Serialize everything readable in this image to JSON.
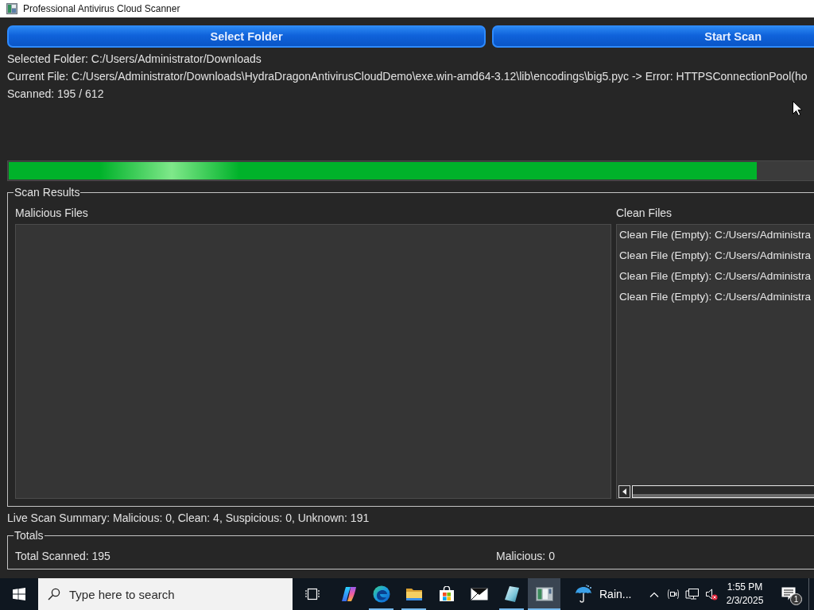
{
  "window": {
    "title": "Professional Antivirus Cloud Scanner"
  },
  "buttons": [
    {
      "label": "Select Folder"
    },
    {
      "label": "Start Scan"
    }
  ],
  "status": {
    "selected_folder": "Selected Folder: C:/Users/Administrator/Downloads",
    "current_file": "Current File: C:/Users/Administrator/Downloads\\HydraDragonAntivirusCloudDemo\\exe.win-amd64-3.12\\lib\\encodings\\big5.pyc -> Error: HTTPSConnectionPool(ho",
    "scanned": "Scanned: 195 / 612"
  },
  "progress": {
    "level": 0.93
  },
  "scan_results": {
    "title": "Scan Results",
    "malicious_files": {
      "label": "Malicious Files"
    },
    "clean_files": {
      "label": "Clean Files",
      "items": [
        "Clean File (Empty): C:/Users/Administra",
        "Clean File (Empty): C:/Users/Administra",
        "Clean File (Empty): C:/Users/Administra",
        "Clean File (Empty): C:/Users/Administra"
      ]
    }
  },
  "summary": "Live Scan Summary: Malicious: 0, Clean: 4, Suspicious: 0, Unknown: 191",
  "totals": {
    "title": "Totals",
    "total_scanned": "Total Scanned: 195",
    "malicious": "Malicious: 0"
  },
  "taskbar": {
    "search": {
      "placeholder": "Type here to search"
    },
    "apps": [
      {
        "kind": "swirl",
        "running": false,
        "selected": false
      },
      {
        "kind": "globe",
        "running": true,
        "selected": false
      },
      {
        "kind": "folder",
        "running": true,
        "selected": false
      },
      {
        "kind": "bag",
        "running": false,
        "selected": false
      },
      {
        "kind": "envelope",
        "running": false,
        "selected": false
      },
      {
        "kind": "note",
        "running": true,
        "selected": false
      },
      {
        "kind": "window",
        "running": true,
        "selected": true
      }
    ],
    "weather": "Rain...",
    "tray": {
      "volume_muted": true
    },
    "clock": {
      "time": "1:55 PM",
      "date": "2/3/2025"
    },
    "notifications": "1"
  }
}
